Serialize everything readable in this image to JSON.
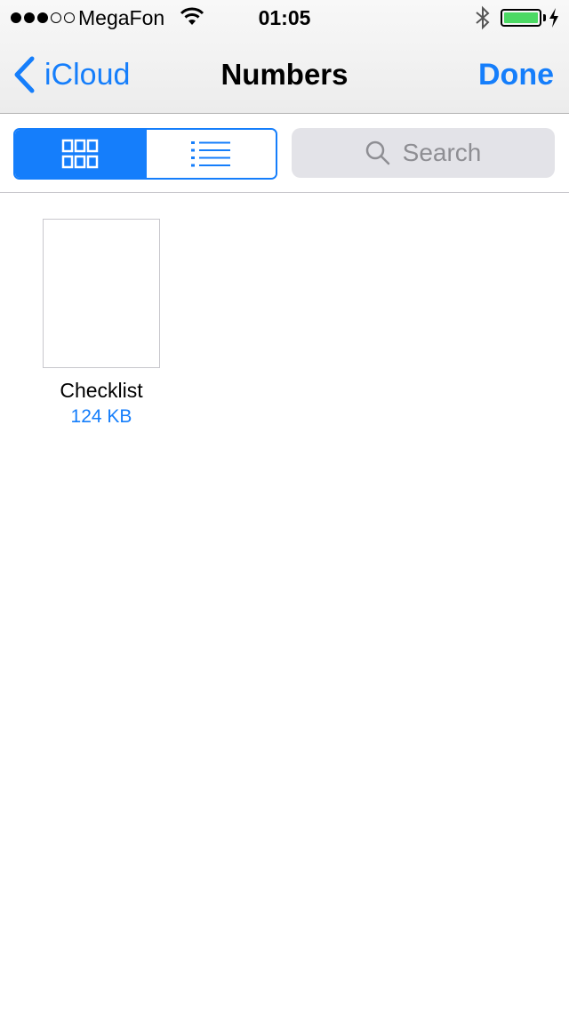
{
  "status_bar": {
    "signal_dots_filled": 3,
    "signal_dots_total": 5,
    "carrier": "MegaFon",
    "time": "01:05",
    "battery_level": 1.0
  },
  "navbar": {
    "back_label": "iCloud",
    "title": "Numbers",
    "done_label": "Done"
  },
  "toolbar": {
    "view_modes": [
      "grid-view-icon",
      "list-view-icon"
    ],
    "selected_view": "grid",
    "search_placeholder": "Search"
  },
  "documents": [
    {
      "name": "Checklist",
      "size": "124 KB"
    }
  ],
  "colors": {
    "accent": "#157efb",
    "battery": "#4cd964",
    "search_bg": "#e3e3e8",
    "placeholder": "#8e8e93"
  }
}
